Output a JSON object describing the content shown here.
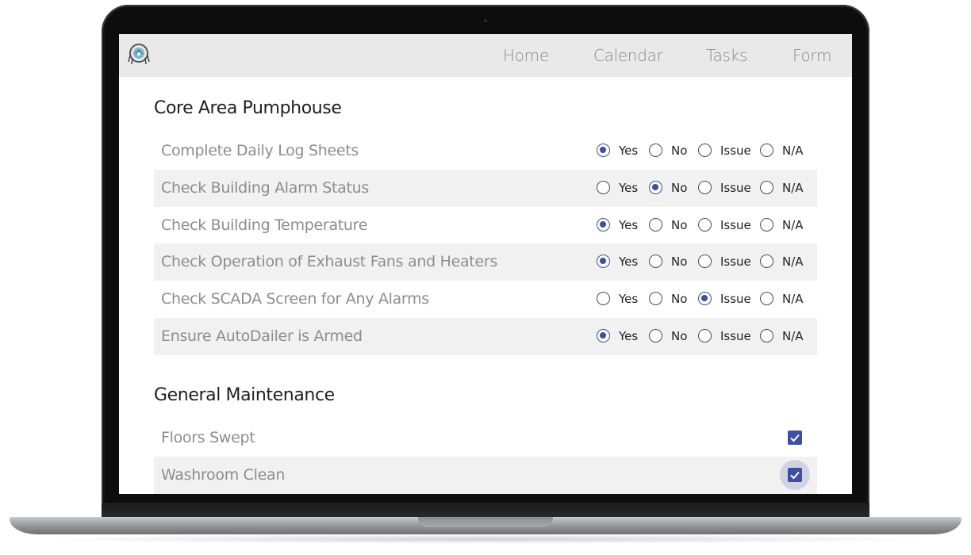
{
  "nav": {
    "links": [
      "Home",
      "Calendar",
      "Tasks",
      "Form"
    ]
  },
  "sections": [
    {
      "title": "Core Area Pumphouse",
      "options": [
        "Yes",
        "No",
        "Issue",
        "N/A"
      ],
      "items": [
        {
          "label": "Complete Daily Log Sheets",
          "selected": "Yes"
        },
        {
          "label": "Check Building Alarm Status",
          "selected": "No"
        },
        {
          "label": "Check Building Temperature",
          "selected": "Yes"
        },
        {
          "label": "Check Operation of Exhaust Fans and Heaters",
          "selected": "Yes"
        },
        {
          "label": "Check SCADA Screen for Any Alarms",
          "selected": "Issue"
        },
        {
          "label": "Ensure AutoDailer is Armed",
          "selected": "Yes"
        }
      ]
    },
    {
      "title": "General Maintenance",
      "items": [
        {
          "label": "Floors Swept",
          "checked": true
        },
        {
          "label": "Washroom Clean",
          "checked": true,
          "focused": true
        }
      ]
    }
  ],
  "colors": {
    "accent": "#3c4fa3",
    "navbar": "#e9e9e9",
    "row_shade": "#f1f1f1"
  }
}
